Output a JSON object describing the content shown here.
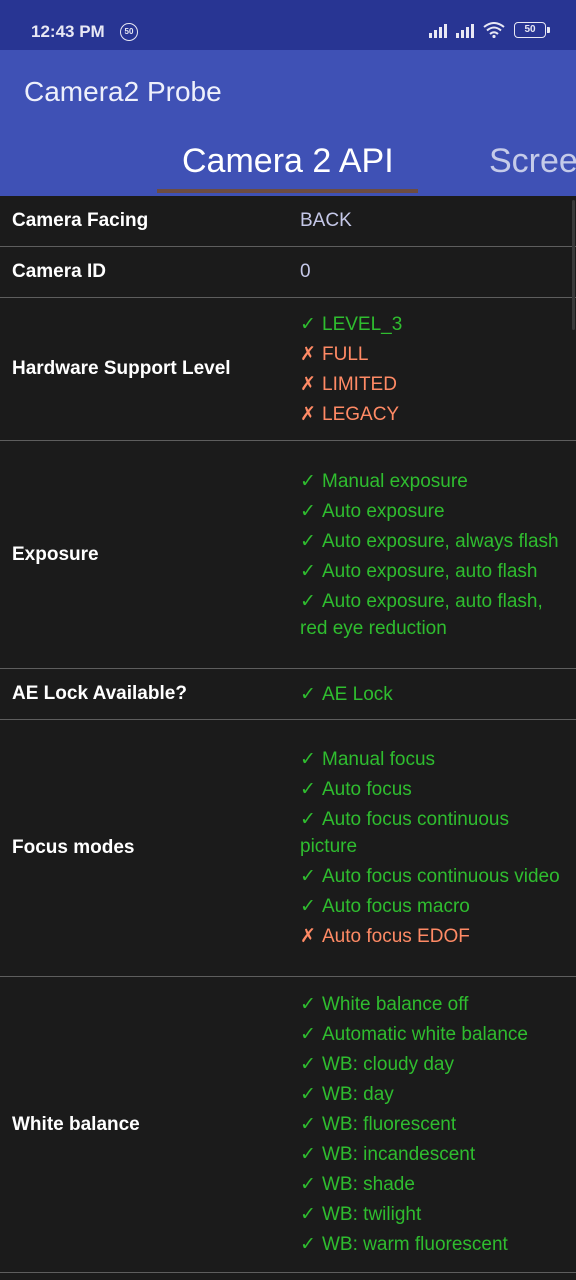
{
  "status_bar": {
    "time": "12:43 PM",
    "notification_badge": "50",
    "battery": "50",
    "icons": [
      "signal-icon",
      "signal-icon",
      "wifi-icon",
      "battery-icon"
    ]
  },
  "app": {
    "title": "Camera2 Probe"
  },
  "tabs": [
    {
      "label": "Camera 2 API",
      "active": true
    },
    {
      "label": "Scree",
      "active": false
    }
  ],
  "colors": {
    "primary": "#3f51b5",
    "status": "#283593",
    "supported": "#2fbd2f",
    "unsupported": "#ff8a65",
    "indicator": "#6d4c41"
  },
  "rows": [
    {
      "label": "Camera Facing",
      "value": "BACK"
    },
    {
      "label": "Camera ID",
      "value": "0"
    },
    {
      "label": "Hardware Support Level",
      "items": [
        {
          "mark": "✓",
          "text": "LEVEL_3",
          "ok": true
        },
        {
          "mark": "✗",
          "text": "FULL",
          "ok": false
        },
        {
          "mark": "✗",
          "text": "LIMITED",
          "ok": false
        },
        {
          "mark": "✗",
          "text": "LEGACY",
          "ok": false
        }
      ]
    },
    {
      "label": "Exposure",
      "items": [
        {
          "mark": "✓",
          "text": "Manual exposure",
          "ok": true
        },
        {
          "mark": "✓",
          "text": "Auto exposure",
          "ok": true
        },
        {
          "mark": "✓",
          "text": "Auto exposure, always flash",
          "ok": true
        },
        {
          "mark": "✓",
          "text": "Auto exposure, auto flash",
          "ok": true
        },
        {
          "mark": "✓",
          "text": "Auto exposure, auto flash, red eye reduction",
          "ok": true
        }
      ]
    },
    {
      "label": "AE Lock Available?",
      "items": [
        {
          "mark": "✓",
          "text": "AE Lock",
          "ok": true
        }
      ]
    },
    {
      "label": "Focus modes",
      "items": [
        {
          "mark": "✓",
          "text": "Manual focus",
          "ok": true
        },
        {
          "mark": "✓",
          "text": "Auto focus",
          "ok": true
        },
        {
          "mark": "✓",
          "text": "Auto focus continuous picture",
          "ok": true
        },
        {
          "mark": "✓",
          "text": "Auto focus continuous video",
          "ok": true
        },
        {
          "mark": "✓",
          "text": "Auto focus macro",
          "ok": true
        },
        {
          "mark": "✗",
          "text": "Auto focus EDOF",
          "ok": false
        }
      ]
    },
    {
      "label": "White balance",
      "items": [
        {
          "mark": "✓",
          "text": "White balance off",
          "ok": true
        },
        {
          "mark": "✓",
          "text": "Automatic white balance",
          "ok": true
        },
        {
          "mark": "✓",
          "text": "WB: cloudy day",
          "ok": true
        },
        {
          "mark": "✓",
          "text": "WB: day",
          "ok": true
        },
        {
          "mark": "✓",
          "text": "WB: fluorescent",
          "ok": true
        },
        {
          "mark": "✓",
          "text": "WB: incandescent",
          "ok": true
        },
        {
          "mark": "✓",
          "text": "WB: shade",
          "ok": true
        },
        {
          "mark": "✓",
          "text": "WB: twilight",
          "ok": true
        },
        {
          "mark": "✓",
          "text": "WB: warm fluorescent",
          "ok": true
        }
      ]
    }
  ]
}
